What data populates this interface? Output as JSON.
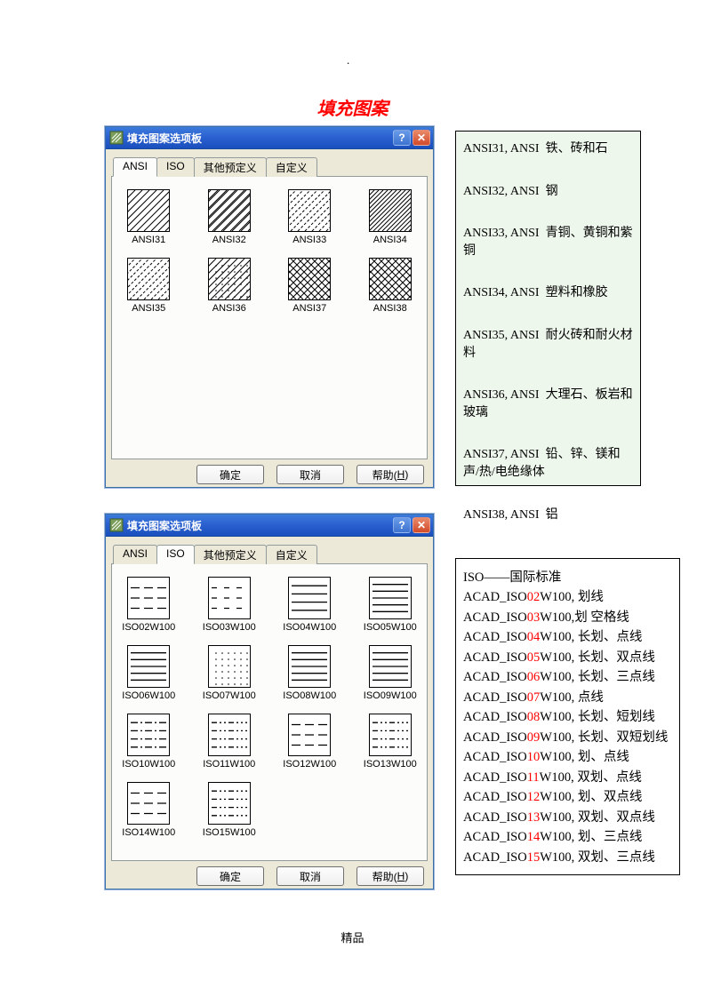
{
  "page": {
    "dot": ".",
    "title": "填充图案",
    "footer": "精品"
  },
  "dialog": {
    "title": "填充图案选项板",
    "tabs": {
      "ansi": "ANSI",
      "iso": "ISO",
      "other": "其他预定义",
      "custom": "自定义"
    },
    "buttons": {
      "ok": "确定",
      "cancel": "取消",
      "help_pre": "帮助(",
      "help_u": "H",
      "help_post": ")"
    },
    "help_symbol": "?",
    "close_symbol": "✕"
  },
  "ansi": {
    "swatches": [
      {
        "id": "ANSI31",
        "pattern": "diag45"
      },
      {
        "id": "ANSI32",
        "pattern": "diag45-double"
      },
      {
        "id": "ANSI33",
        "pattern": "diag45-alt"
      },
      {
        "id": "ANSI34",
        "pattern": "diag45-dense"
      },
      {
        "id": "ANSI35",
        "pattern": "diag45-dash"
      },
      {
        "id": "ANSI36",
        "pattern": "diag45-dot"
      },
      {
        "id": "ANSI37",
        "pattern": "cross45"
      },
      {
        "id": "ANSI38",
        "pattern": "cross45-mix"
      }
    ],
    "descriptions": [
      {
        "code": "ANSI31, ANSI",
        "text": "铁、砖和石"
      },
      {
        "code": "ANSI32, ANSI",
        "text": "钢"
      },
      {
        "code": "ANSI33, ANSI",
        "text": "青铜、黄铜和紫铜"
      },
      {
        "code": "ANSI34, ANSI",
        "text": "塑料和橡胶"
      },
      {
        "code": "ANSI35, ANSI",
        "text": "耐火砖和耐火材料"
      },
      {
        "code": "ANSI36, ANSI",
        "text": "大理石、板岩和玻璃"
      },
      {
        "code": "ANSI37, ANSI",
        "text": "铅、锌、镁和声/热/电绝缘体"
      },
      {
        "code": "ANSI38, ANSI",
        "text": "铝"
      }
    ]
  },
  "iso": {
    "swatches": [
      {
        "id": "ISO02W100",
        "pattern": "h-dash-3"
      },
      {
        "id": "ISO03W100",
        "pattern": "h-dash-sp"
      },
      {
        "id": "ISO04W100",
        "pattern": "h-solid-4"
      },
      {
        "id": "ISO05W100",
        "pattern": "h-solid-5"
      },
      {
        "id": "ISO06W100",
        "pattern": "h-solid-5"
      },
      {
        "id": "ISO07W100",
        "pattern": "dots"
      },
      {
        "id": "ISO08W100",
        "pattern": "h-solid-5"
      },
      {
        "id": "ISO09W100",
        "pattern": "h-solid-5"
      },
      {
        "id": "ISO10W100",
        "pattern": "h-dash-mix"
      },
      {
        "id": "ISO11W100",
        "pattern": "h-dash-mix2"
      },
      {
        "id": "ISO12W100",
        "pattern": "h-dash-3"
      },
      {
        "id": "ISO13W100",
        "pattern": "h-dash-mix2"
      },
      {
        "id": "ISO14W100",
        "pattern": "h-dash-3"
      },
      {
        "id": "ISO15W100",
        "pattern": "h-dash-mix2"
      }
    ],
    "header": "ISO——国际标准",
    "descriptions": [
      {
        "pre": "ACAD_ISO",
        "num": "02",
        "post": "W100, 划线"
      },
      {
        "pre": "ACAD_ISO",
        "num": "03",
        "post": "W100,划 空格线"
      },
      {
        "pre": "ACAD_ISO",
        "num": "04",
        "post": "W100, 长划、点线"
      },
      {
        "pre": "ACAD_ISO",
        "num": "05",
        "post": "W100, 长划、双点线"
      },
      {
        "pre": "ACAD_ISO",
        "num": "06",
        "post": "W100, 长划、三点线"
      },
      {
        "pre": "ACAD_ISO",
        "num": "07",
        "post": "W100, 点线"
      },
      {
        "pre": "ACAD_ISO",
        "num": "08",
        "post": "W100, 长划、短划线"
      },
      {
        "pre": "ACAD_ISO",
        "num": "09",
        "post": "W100, 长划、双短划线"
      },
      {
        "pre": "ACAD_ISO",
        "num": "10",
        "post": "W100, 划、点线"
      },
      {
        "pre": "ACAD_ISO",
        "num": "11",
        "post": "W100, 双划、点线"
      },
      {
        "pre": "ACAD_ISO",
        "num": "12",
        "post": "W100, 划、双点线"
      },
      {
        "pre": "ACAD_ISO",
        "num": "13",
        "post": "W100, 双划、双点线"
      },
      {
        "pre": "ACAD_ISO",
        "num": "14",
        "post": "W100, 划、三点线"
      },
      {
        "pre": "ACAD_ISO",
        "num": "15",
        "post": "W100, 双划、三点线"
      }
    ]
  }
}
